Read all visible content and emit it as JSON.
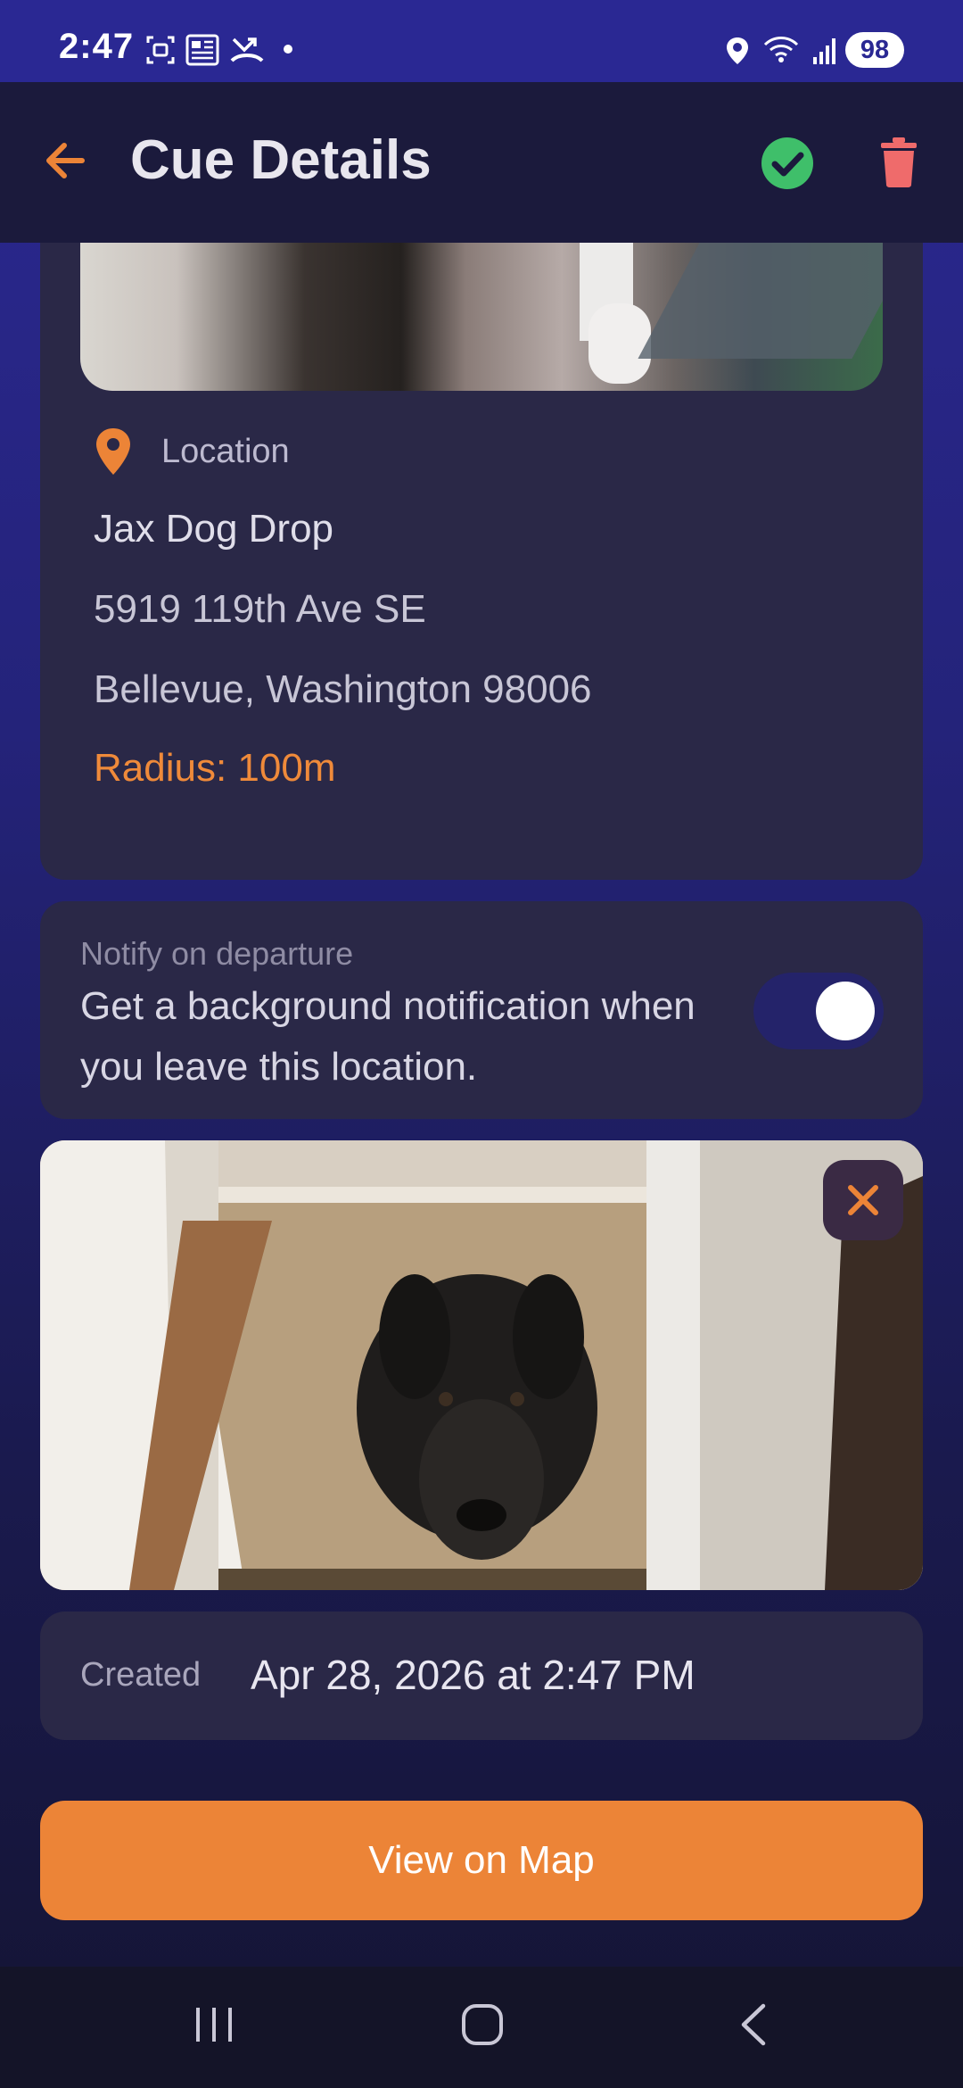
{
  "status_bar": {
    "time": "2:47",
    "battery": "98",
    "icons": [
      "screenshot-icon",
      "news-icon",
      "missed-call-icon",
      "dot-icon",
      "location-icon",
      "wifi-icon",
      "signal-icon"
    ]
  },
  "app_bar": {
    "title": "Cue Details",
    "back_icon": "arrow-left-icon",
    "confirm_icon": "check-circle-icon",
    "delete_icon": "trash-icon"
  },
  "location": {
    "label": "Location",
    "name": "Jax Dog Drop",
    "street": "5919 119th Ave SE",
    "city_line": "Bellevue, Washington 98006",
    "radius": "Radius: 100m"
  },
  "notify": {
    "caption": "Notify on departure",
    "description": "Get a background notification when you leave this location.",
    "enabled": true
  },
  "created": {
    "label": "Created",
    "value": "Apr 28, 2026 at 2:47 PM"
  },
  "actions": {
    "view_on_map": "View on Map"
  },
  "colors": {
    "accent": "#ec8437",
    "success": "#3fbf6a",
    "danger": "#ef6b6b",
    "card": "#2a2847"
  },
  "nav": [
    "recents-icon",
    "home-icon",
    "back-icon"
  ]
}
